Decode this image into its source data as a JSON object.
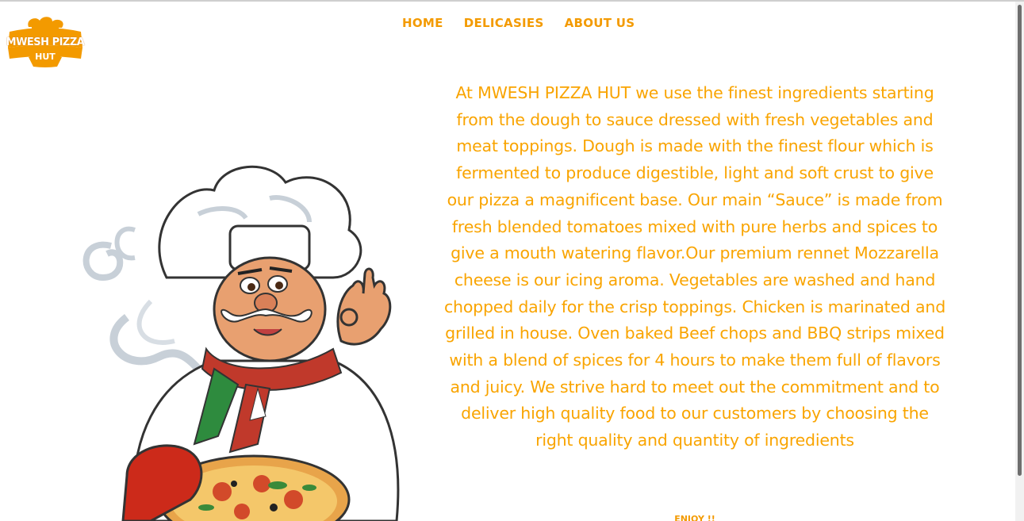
{
  "logo": {
    "line1": "MWESH PIZZA",
    "line2": "HUT"
  },
  "nav": {
    "items": [
      {
        "label": "HOME"
      },
      {
        "label": "DELICASIES"
      },
      {
        "label": "ABOUT US"
      }
    ]
  },
  "main": {
    "description": "At MWESH PIZZA HUT we use the finest ingredients starting from the dough to sauce dressed with fresh vegetables and meat toppings. Dough is made with the finest flour which is fermented to produce digestible, light and soft crust to give our pizza a magnificent base. Our main “Sauce” is made from fresh blended tomatoes mixed with pure herbs and spices to give a mouth watering flavor.Our premium rennet Mozzarella cheese is our icing aroma. Vegetables are washed and hand chopped daily for the crisp toppings. Chicken is marinated and grilled in house. Oven baked Beef chops and BBQ strips mixed with a blend of spices for 4 hours to make them full of flavors and juicy. We strive hard to meet out the commitment and to deliver high quality food to our customers by choosing the right quality and quantity of ingredients",
    "enjoy": "ENJOY !!"
  },
  "colors": {
    "accent": "#f39a00",
    "text": "#f9a400"
  },
  "icons": {
    "logo": "chef-hat-logo-icon",
    "illustration": "pizza-chef-illustration"
  }
}
